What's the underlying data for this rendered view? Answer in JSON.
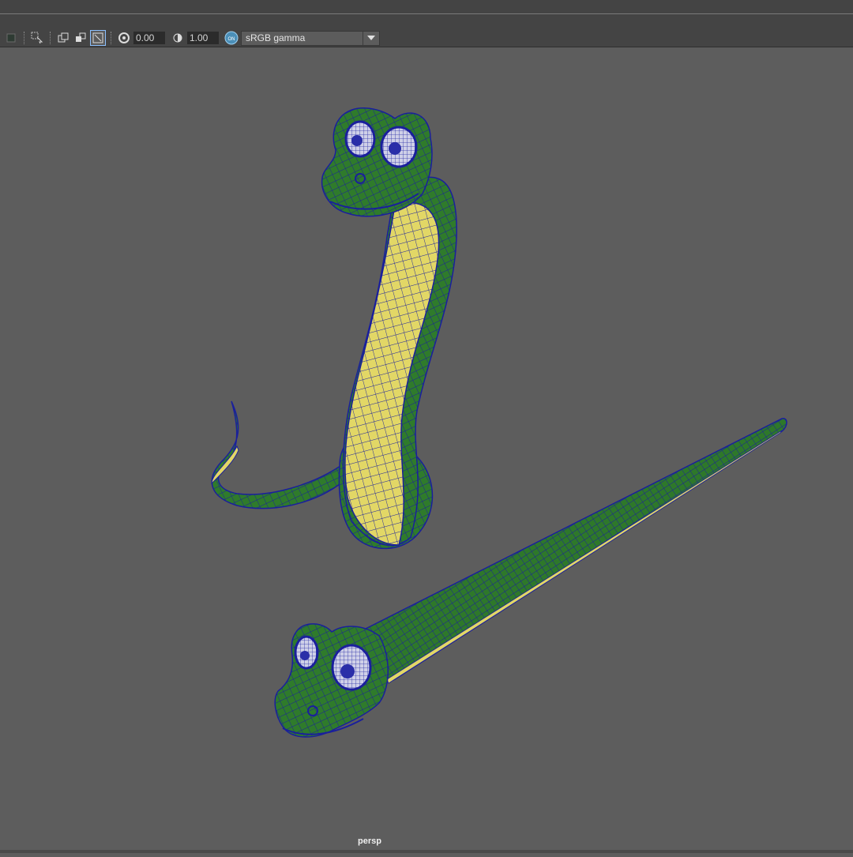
{
  "toolbar": {
    "exposure_value": "0.00",
    "gamma_value": "1.00",
    "color_space": "sRGB gamma",
    "icons": [
      "camera-tools-icon",
      "select-icon",
      "snapshot-icon",
      "isolate-icon",
      "xray-icon",
      "exposure-icon",
      "gamma-icon",
      "color-management-icon",
      "chevron-down-icon"
    ]
  },
  "viewport": {
    "camera_name": "persp",
    "background_color": "#5d5d5d",
    "models": [
      {
        "name": "coiled-snake",
        "body_color": "#2f7b2b",
        "belly_color": "#e2d766",
        "wire_color": "#1a1f9c"
      },
      {
        "name": "straight-snake",
        "body_color": "#2f7b2b",
        "belly_color": "#e2d766",
        "wire_color": "#1a1f9c"
      }
    ]
  }
}
